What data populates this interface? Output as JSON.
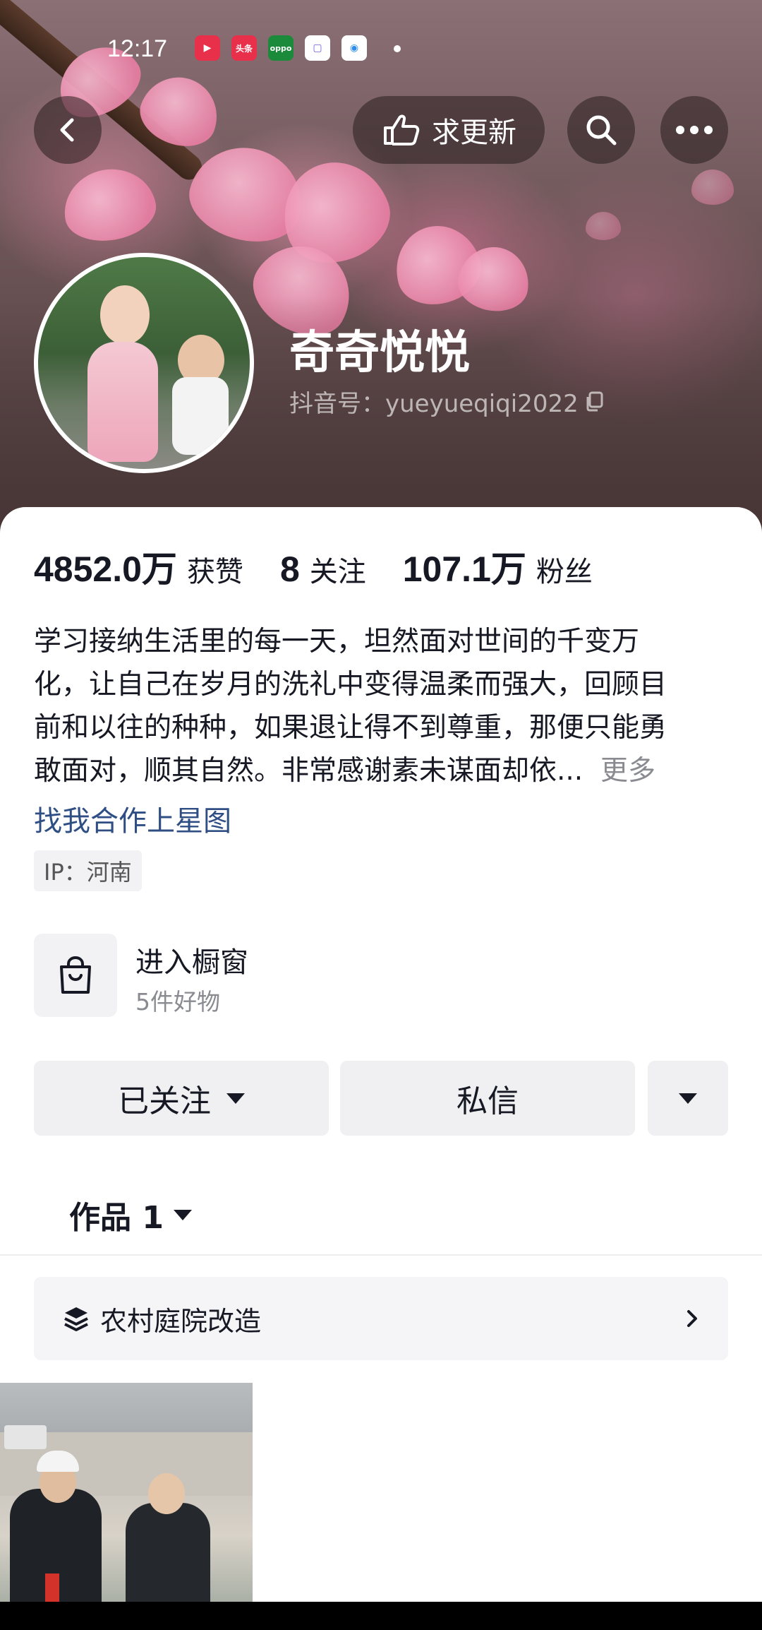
{
  "status_bar": {
    "time": "12:17",
    "apps": [
      {
        "name": "video-app-icon",
        "color": "#e8304b",
        "label": "▶"
      },
      {
        "name": "toutiao-app-icon",
        "color": "#e8304b",
        "label": "头条"
      },
      {
        "name": "oppo-app-icon",
        "color": "#1b8a3a",
        "label": "oppo"
      },
      {
        "name": "chat-app-icon",
        "color": "#6b5bd6",
        "label": "▢"
      },
      {
        "name": "browser-app-icon",
        "color": "#2d8cf0",
        "label": "◉"
      }
    ]
  },
  "top_nav": {
    "back_icon": "chevron-left-icon",
    "request_update_label": "求更新",
    "search_icon": "search-icon",
    "more_icon": "more-dots-icon"
  },
  "profile": {
    "nickname": "奇奇悦悦",
    "douyin_id": "抖音号：yueyueqiqi2022",
    "copy_icon": "copy-icon"
  },
  "stats": {
    "likes_value": "4852.0万",
    "likes_label": "获赞",
    "following_value": "8",
    "following_label": "关注",
    "followers_value": "107.1万",
    "followers_label": "粉丝"
  },
  "bio": {
    "lines": [
      "学习接纳生活里的每一天，坦然面对世间的千变万",
      "化，让自己在岁月的洗礼中变得温柔而强大，回顾目",
      "前和以往的种种，如果退让得不到尊重，那便只能勇",
      "敢面对，顺其自然。非常感谢素未谋面却依..."
    ],
    "more_label": "更多",
    "starmap_link": "找我合作上星图",
    "ip_label": "IP：河南"
  },
  "shop": {
    "title": "进入橱窗",
    "subtitle": "5件好物",
    "icon": "shopping-bag-icon"
  },
  "actions": {
    "followed_label": "已关注",
    "message_label": "私信"
  },
  "works": {
    "tab_label": "作品 1",
    "collection_label": "农村庭院改造",
    "collection_icon": "layers-icon"
  },
  "colors": {
    "link": "#2f4f84",
    "muted": "#8a8b91",
    "button_bg": "#f0f0f2"
  }
}
